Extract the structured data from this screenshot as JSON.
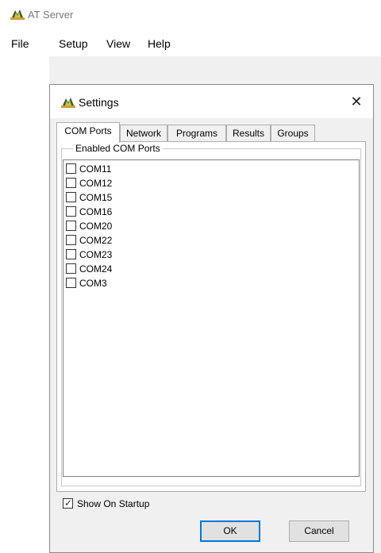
{
  "window": {
    "title": "AT Server",
    "icon": "app-logo-icon"
  },
  "menu": {
    "items": [
      {
        "label": "File"
      },
      {
        "label": "Setup"
      },
      {
        "label": "View"
      },
      {
        "label": "Help"
      }
    ]
  },
  "dialog": {
    "title": "Settings",
    "icon": "app-logo-icon",
    "close_icon": "close-icon",
    "tabs": [
      {
        "label": "COM Ports",
        "active": true
      },
      {
        "label": "Network"
      },
      {
        "label": "Programs"
      },
      {
        "label": "Results"
      },
      {
        "label": "Groups"
      }
    ],
    "group_label": "Enabled COM Ports",
    "ports": [
      {
        "label": "COM11",
        "checked": false
      },
      {
        "label": "COM12",
        "checked": false
      },
      {
        "label": "COM15",
        "checked": false
      },
      {
        "label": "COM16",
        "checked": false
      },
      {
        "label": "COM20",
        "checked": false
      },
      {
        "label": "COM22",
        "checked": false
      },
      {
        "label": "COM23",
        "checked": false
      },
      {
        "label": "COM24",
        "checked": false
      },
      {
        "label": "COM3",
        "checked": false
      }
    ],
    "show_on_startup": {
      "label": "Show On Startup",
      "checked": true
    },
    "ok_label": "OK",
    "cancel_label": "Cancel"
  }
}
